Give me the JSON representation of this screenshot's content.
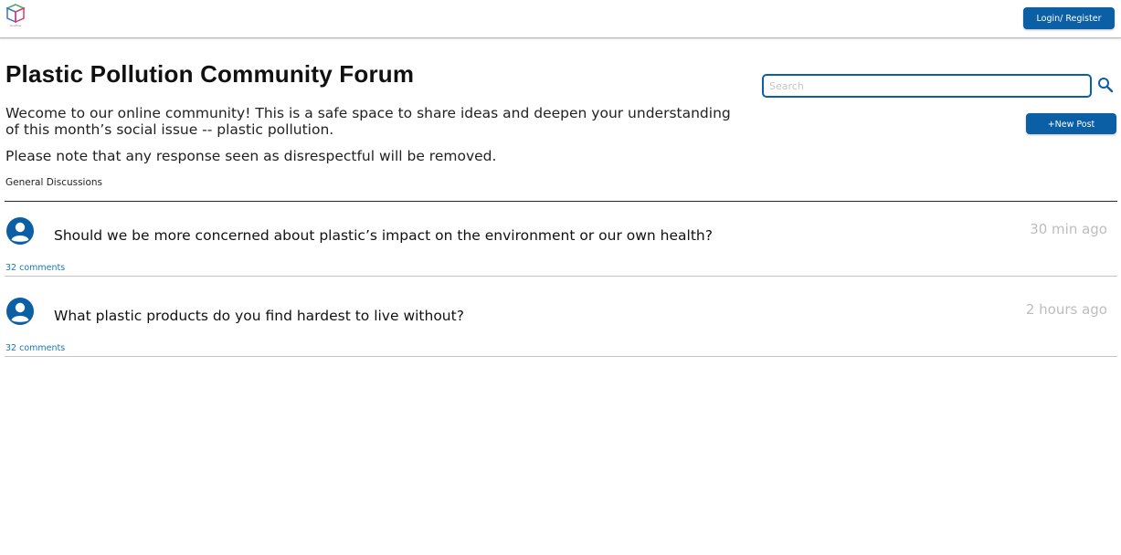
{
  "header": {
    "logo_text": "tensflow",
    "login_label": "Login/ Register"
  },
  "main": {
    "title": "Plastic Pollution Community Forum",
    "intro": "Wecome to our online community! This is a safe space to share ideas and deepen your understanding of this month’s social issue -- plastic pollution.",
    "note": "Please note that any response seen as disrespectful will be removed.",
    "section_label": "General Discussions"
  },
  "search": {
    "placeholder": "Search",
    "value": ""
  },
  "actions": {
    "new_post_label": "+New Post"
  },
  "posts": [
    {
      "title": "Should we be more concerned about plastic’s impact on the environment or our own health?",
      "time": "30 min ago",
      "comments": "32 comments"
    },
    {
      "title": "What plastic products do you find hardest to live without?",
      "time": "2 hours ago",
      "comments": "32 comments"
    }
  ],
  "colors": {
    "accent": "#0b5fa5",
    "link": "#1577c4",
    "muted": "#bdbdbd"
  },
  "icons": {
    "logo": "cube-logo-icon",
    "search": "search-icon",
    "avatar": "user-avatar-icon"
  }
}
